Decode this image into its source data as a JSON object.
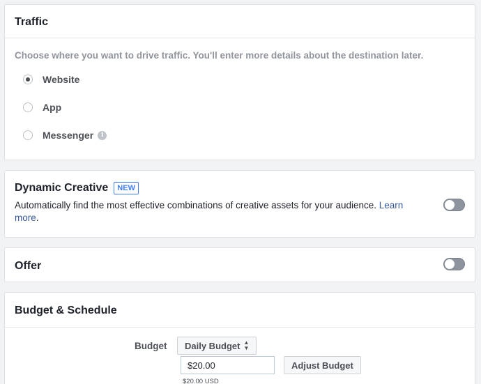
{
  "traffic": {
    "title": "Traffic",
    "description": "Choose where you want to drive traffic. You'll enter more details about the destination later.",
    "options": [
      {
        "label": "Website",
        "selected": true
      },
      {
        "label": "App",
        "selected": false
      },
      {
        "label": "Messenger",
        "selected": false
      }
    ],
    "info_icon_glyph": "i"
  },
  "dynamic_creative": {
    "title": "Dynamic Creative",
    "badge": "NEW",
    "description": "Automatically find the most effective combinations of creative assets for your audience. ",
    "link_text": "Learn more",
    "period": ".",
    "enabled": false
  },
  "offer": {
    "title": "Offer",
    "enabled": false
  },
  "budget_schedule": {
    "title": "Budget & Schedule",
    "budget_label": "Budget",
    "budget_type": "Daily Budget",
    "amount": "$20.00",
    "adjust_label": "Adjust Budget",
    "usd_note": "$20.00 USD"
  },
  "colors": {
    "link": "#365899",
    "badge": "#4080ff",
    "toggle_off": "#8d949e"
  }
}
